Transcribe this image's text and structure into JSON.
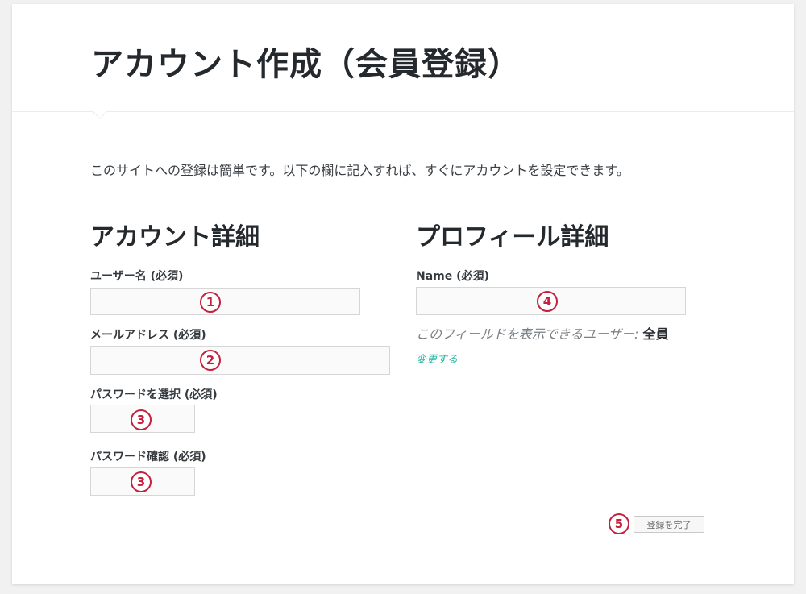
{
  "page": {
    "title": "アカウント作成（会員登録）",
    "intro": "このサイトへの登録は簡単です。以下の欄に記入すれば、すぐにアカウントを設定できます。"
  },
  "account": {
    "heading": "アカウント詳細",
    "username_label": "ユーザー名 (必須)",
    "email_label": "メールアドレス (必須)",
    "password_label": "パスワードを選択 (必須)",
    "password_confirm_label": "パスワード確認 (必須)"
  },
  "profile": {
    "heading": "プロフィール詳細",
    "name_label": "Name (必須)",
    "visibility_prefix": "このフィールドを表示できるユーザー: ",
    "visibility_value": "全員",
    "change_link": "変更する"
  },
  "submit": {
    "label": "登録を完了"
  },
  "markers": {
    "username": "1",
    "email": "2",
    "password": "3",
    "password_confirm": "3",
    "name": "4",
    "submit": "5"
  },
  "colors": {
    "marker": "#c4213f",
    "link": "#2bb7a5"
  }
}
